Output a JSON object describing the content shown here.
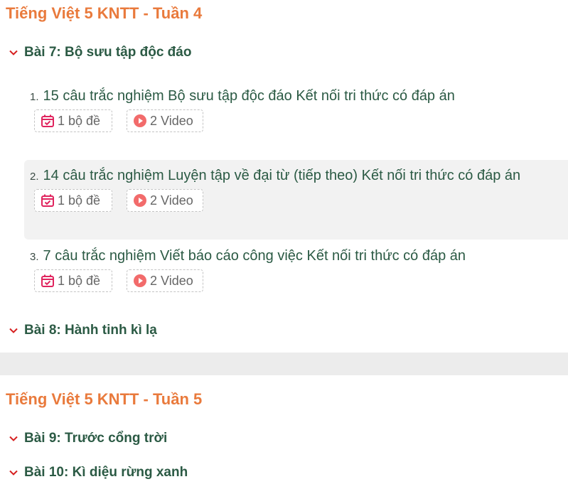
{
  "weeks": [
    {
      "title": "Tiếng Việt 5 KNTT - Tuần 4",
      "lessons": [
        {
          "title": "Bài 7: Bộ sưu tập độc đáo",
          "items": [
            {
              "num": "1.",
              "title": "15 câu trắc nghiệm Bộ sưu tập độc đáo Kết nối tri thức có đáp án",
              "quiz": "1 bộ đề",
              "video": "2 Video"
            },
            {
              "num": "2.",
              "title": "14 câu trắc nghiệm Luyện tập về đại từ (tiếp theo) Kết nối tri thức có đáp án",
              "quiz": "1 bộ đề",
              "video": "2 Video"
            },
            {
              "num": "3.",
              "title": "7 câu trắc nghiệm Viết báo cáo công việc Kết nối tri thức có đáp án",
              "quiz": "1 bộ đề",
              "video": "2 Video"
            }
          ]
        },
        {
          "title": "Bài 8: Hành tinh kì lạ"
        }
      ]
    },
    {
      "title": "Tiếng Việt 5 KNTT - Tuần 5",
      "lessons": [
        {
          "title": "Bài 9: Trước cổng trời"
        },
        {
          "title": "Bài 10: Kì diệu rừng xanh"
        }
      ]
    }
  ],
  "icons": {
    "chevron": "chevron-down-icon",
    "quiz": "calendar-check-icon",
    "video": "play-circle-icon"
  },
  "colors": {
    "week_title": "#e97a3c",
    "lesson_title": "#2b5a44",
    "chevron": "#d62020",
    "quiz_icon": "#e0245e",
    "video_icon": "#f26b6b",
    "highlight_bg": "#f2f2f2",
    "divider": "#ececec"
  }
}
